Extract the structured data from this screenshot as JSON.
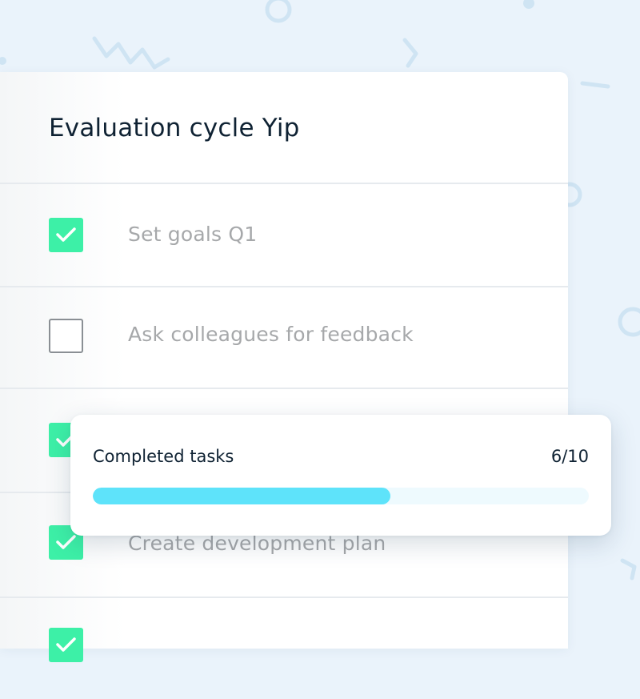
{
  "checklist": {
    "title": "Evaluation cycle Yip",
    "tasks": [
      {
        "label": "Set goals Q1",
        "checked": true
      },
      {
        "label": "Ask colleagues for feedback",
        "checked": false
      },
      {
        "label": "",
        "checked": true
      },
      {
        "label": "Create development plan",
        "checked": true
      },
      {
        "label": "",
        "checked": true
      }
    ]
  },
  "progress": {
    "title": "Completed tasks",
    "count": "6/10",
    "completed": 6,
    "total": 10
  },
  "colors": {
    "checked": "#3df0a7",
    "progress_fill": "#5ee3fa",
    "progress_track": "#eefafe",
    "background": "#eaf3fb",
    "title_text": "#0f2233",
    "muted_text": "#a6a8aa"
  }
}
